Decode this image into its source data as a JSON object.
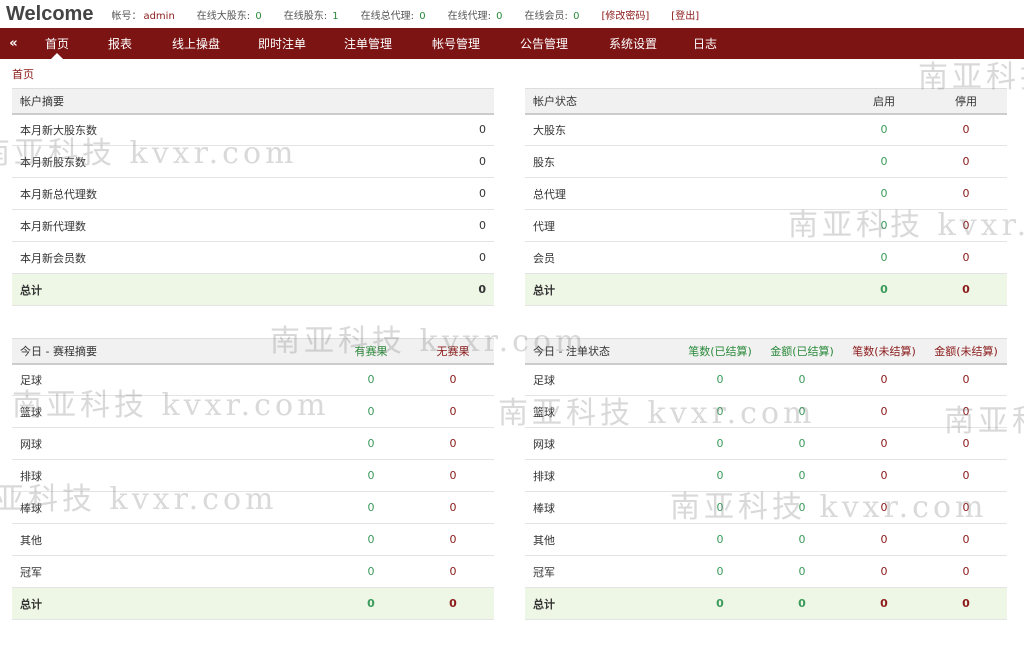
{
  "header": {
    "brand": "Welcome",
    "account_label": "帐号：",
    "account_value": "admin",
    "stats": [
      {
        "label": "在线大股东:",
        "value": "0"
      },
      {
        "label": "在线股东:",
        "value": "1"
      },
      {
        "label": "在线总代理:",
        "value": "0"
      },
      {
        "label": "在线代理:",
        "value": "0"
      },
      {
        "label": "在线会员:",
        "value": "0"
      }
    ],
    "change_password": "[修改密码]",
    "logout": "[登出]"
  },
  "nav": {
    "collapse_icon": "double-chevron-left-icon",
    "tabs": [
      "首页",
      "报表",
      "线上操盘",
      "即时注单",
      "注单管理",
      "帐号管理",
      "公告管理",
      "系统设置",
      "日志"
    ]
  },
  "breadcrumb": "首页",
  "account_summary": {
    "title": "帐户摘要",
    "rows": [
      {
        "label": "本月新大股东数",
        "value": "0"
      },
      {
        "label": "本月新股东数",
        "value": "0"
      },
      {
        "label": "本月新总代理数",
        "value": "0"
      },
      {
        "label": "本月新代理数",
        "value": "0"
      },
      {
        "label": "本月新会员数",
        "value": "0"
      }
    ],
    "total_label": "总计",
    "total_value": "0"
  },
  "account_status": {
    "title": "帐户状态",
    "col_enabled": "启用",
    "col_disabled": "停用",
    "rows": [
      {
        "label": "大股东",
        "enabled": "0",
        "disabled": "0"
      },
      {
        "label": "股东",
        "enabled": "0",
        "disabled": "0"
      },
      {
        "label": "总代理",
        "enabled": "0",
        "disabled": "0"
      },
      {
        "label": "代理",
        "enabled": "0",
        "disabled": "0"
      },
      {
        "label": "会员",
        "enabled": "0",
        "disabled": "0"
      }
    ],
    "total_label": "总计",
    "total_enabled": "0",
    "total_disabled": "0"
  },
  "schedule_summary": {
    "title": "今日 - 赛程摘要",
    "col_has": "有赛果",
    "col_none": "无赛果",
    "rows": [
      {
        "label": "足球",
        "has": "0",
        "none": "0"
      },
      {
        "label": "篮球",
        "has": "0",
        "none": "0"
      },
      {
        "label": "网球",
        "has": "0",
        "none": "0"
      },
      {
        "label": "排球",
        "has": "0",
        "none": "0"
      },
      {
        "label": "棒球",
        "has": "0",
        "none": "0"
      },
      {
        "label": "其他",
        "has": "0",
        "none": "0"
      },
      {
        "label": "冠军",
        "has": "0",
        "none": "0"
      }
    ],
    "total_label": "总计",
    "total_has": "0",
    "total_none": "0"
  },
  "bet_status": {
    "title": "今日 - 注单状态",
    "col_count_settled": "笔数(已结算)",
    "col_amount_settled": "金额(已结算)",
    "col_count_unsettled": "笔数(未结算)",
    "col_amount_unsettled": "金额(未结算)",
    "rows": [
      {
        "label": "足球",
        "cs": "0",
        "as": "0",
        "cu": "0",
        "au": "0"
      },
      {
        "label": "篮球",
        "cs": "0",
        "as": "0",
        "cu": "0",
        "au": "0"
      },
      {
        "label": "网球",
        "cs": "0",
        "as": "0",
        "cu": "0",
        "au": "0"
      },
      {
        "label": "排球",
        "cs": "0",
        "as": "0",
        "cu": "0",
        "au": "0"
      },
      {
        "label": "棒球",
        "cs": "0",
        "as": "0",
        "cu": "0",
        "au": "0"
      },
      {
        "label": "其他",
        "cs": "0",
        "as": "0",
        "cu": "0",
        "au": "0"
      },
      {
        "label": "冠军",
        "cs": "0",
        "as": "0",
        "cu": "0",
        "au": "0"
      }
    ],
    "total_label": "总计",
    "total_cs": "0",
    "total_as": "0",
    "total_cu": "0",
    "total_au": "0"
  },
  "watermark": "南亚科技 kvxr.com",
  "colors": {
    "nav_bg": "#7d1414",
    "accent_red": "#8b1a1a",
    "accent_green": "#3a9a5a",
    "total_row_bg": "#eef6e6"
  }
}
